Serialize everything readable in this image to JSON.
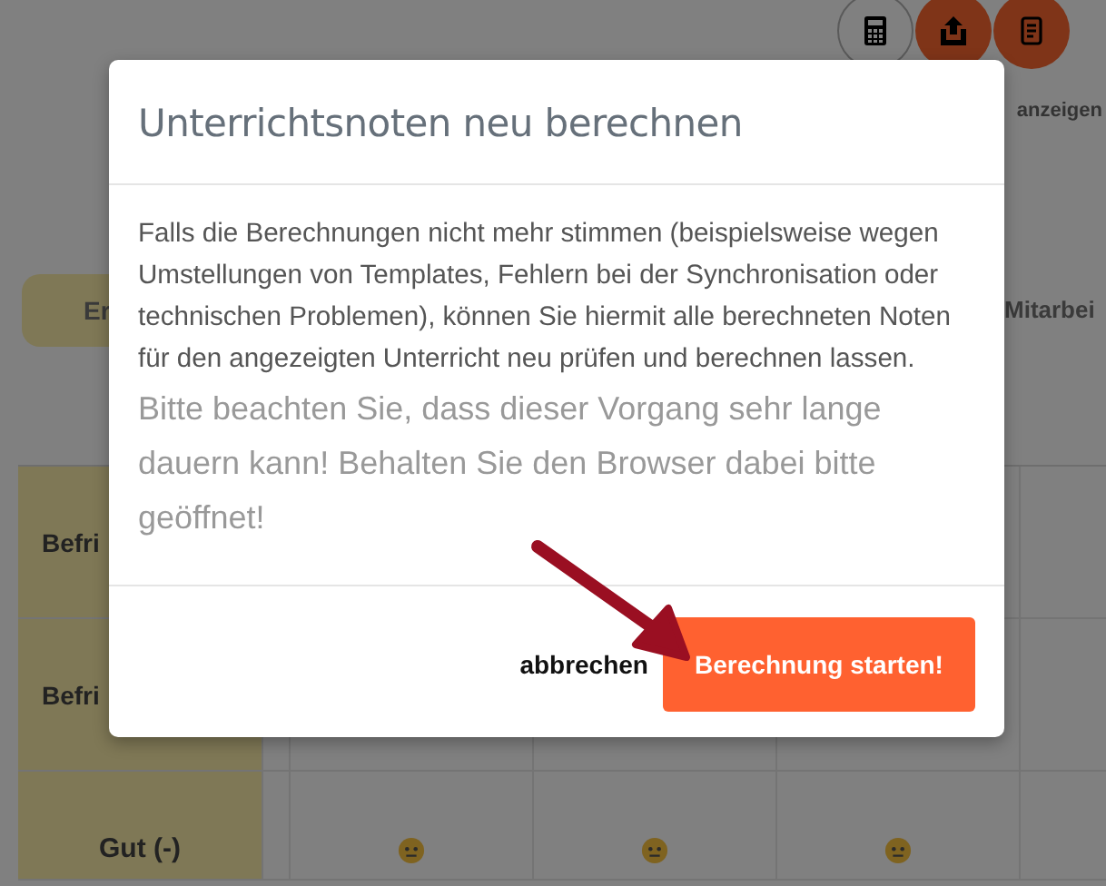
{
  "background": {
    "toolbar_buttons": [
      {
        "kind": "calculator"
      },
      {
        "kind": "upload"
      },
      {
        "kind": "document"
      }
    ],
    "link": "anzeigen",
    "tabs": [
      {
        "label": "Er",
        "selected": true
      },
      {
        "label": "Mitarbei",
        "selected": false
      }
    ],
    "rows": [
      {
        "label": "Befri"
      },
      {
        "label": "Befri"
      }
    ],
    "grade_row": {
      "label": "Gut (-)",
      "cells": [
        {
          "kind": "neutral"
        },
        {
          "kind": "neutral"
        },
        {
          "kind": "neutral"
        }
      ]
    }
  },
  "dialog": {
    "title": "Unterrichtsnoten neu berechnen",
    "body": "Falls die Berechnungen nicht mehr stimmen (beispielsweise wegen Umstellungen von Templates, Fehlern bei der Synchronisation oder technischen Problemen), können Sie hiermit alle berechneten Noten für den angezeigten Unterricht neu prüfen und berechnen lassen.",
    "note": "Bitte beachten Sie, dass dieser Vorgang sehr lange dauern kann! Behalten Sie den Browser dabei bitte geöffnet!",
    "buttons": [
      {
        "label": "abbrechen",
        "kind": "link"
      },
      {
        "label": "Berechnung starten!",
        "kind": "primary"
      }
    ]
  }
}
